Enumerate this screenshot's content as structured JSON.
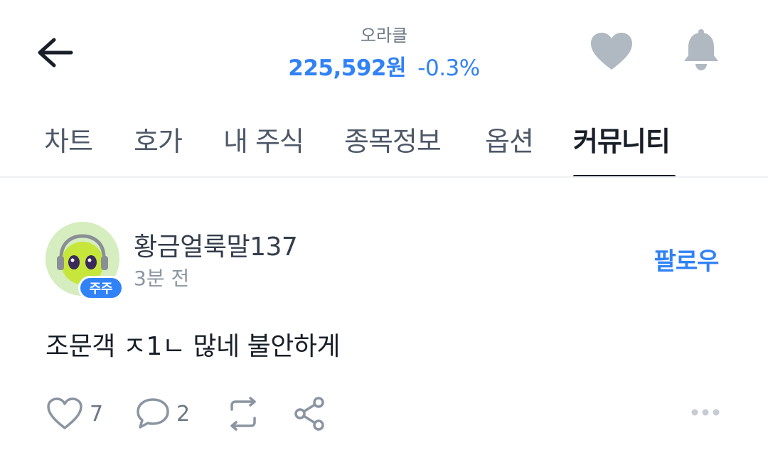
{
  "header": {
    "stock_name": "오라클",
    "price": "225,592원",
    "change": "-0.3%",
    "back_icon": "arrow-left-icon",
    "favorite_icon": "heart-icon",
    "alarm_icon": "bell-icon"
  },
  "tabs": [
    {
      "label": "차트",
      "active": false
    },
    {
      "label": "호가",
      "active": false
    },
    {
      "label": "내 주식",
      "active": false
    },
    {
      "label": "종목정보",
      "active": false
    },
    {
      "label": "옵션",
      "active": false
    },
    {
      "label": "커뮤니티",
      "active": true
    }
  ],
  "post": {
    "author": "황금얼룩말137",
    "badge": "주주",
    "time": "3분 전",
    "follow_label": "팔로우",
    "body": "조문객 ㅈ1ㄴ 많네 불안하게",
    "likes": "7",
    "comments": "2"
  },
  "colors": {
    "accent": "#3182f6",
    "text_primary": "#191f28",
    "text_secondary": "#8b95a1",
    "icon_gray": "#b0b8c1"
  }
}
